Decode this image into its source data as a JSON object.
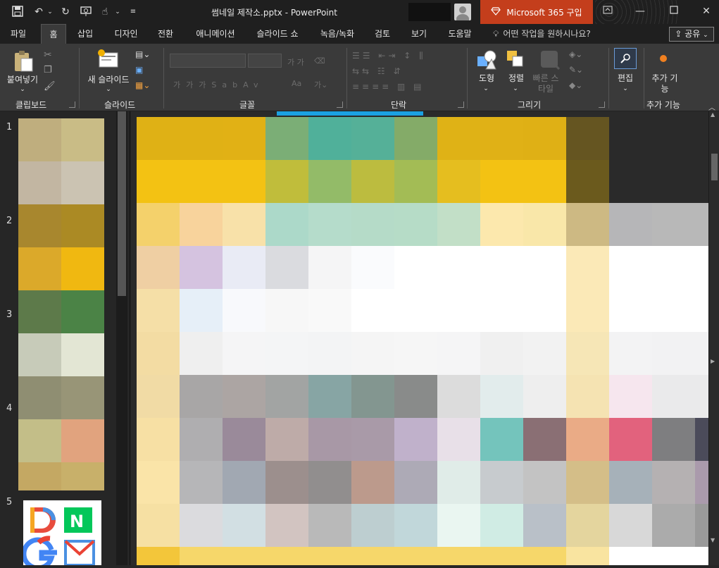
{
  "window": {
    "title": "썸네일 제작소.pptx  -  PowerPoint",
    "m365_label": "Microsoft 365 구입",
    "minimize_icon": "minimize-icon",
    "restore_icon": "restore-icon",
    "close_icon": "close-icon"
  },
  "menu": {
    "tabs": [
      "파일",
      "홈",
      "삽입",
      "디자인",
      "전환",
      "애니메이션",
      "슬라이드 쇼",
      "녹음/녹화",
      "검토",
      "보기",
      "도움말"
    ],
    "active_tab": "홈",
    "tell_me": "어떤 작업을 원하시나요?",
    "share_label": "공유"
  },
  "ribbon": {
    "paste_label": "붙여넣기",
    "clipboard_group": "클립보드",
    "new_slide_label": "새 슬라이드",
    "slides_group": "슬라이드",
    "font_group": "글꼴",
    "paragraph_group": "단락",
    "shape_label": "도형",
    "arrange_label": "정렬",
    "quick_style_label": "빠른 스타일",
    "drawing_group": "그리기",
    "edit_label": "편집",
    "addin_label": "추가 기능",
    "addin_group": "추가 기능"
  },
  "slides": {
    "numbers": [
      "1",
      "2",
      "3",
      "4",
      "5"
    ]
  },
  "colors": {
    "accent": "#c43e1c",
    "selection": "#1ba1e2"
  }
}
